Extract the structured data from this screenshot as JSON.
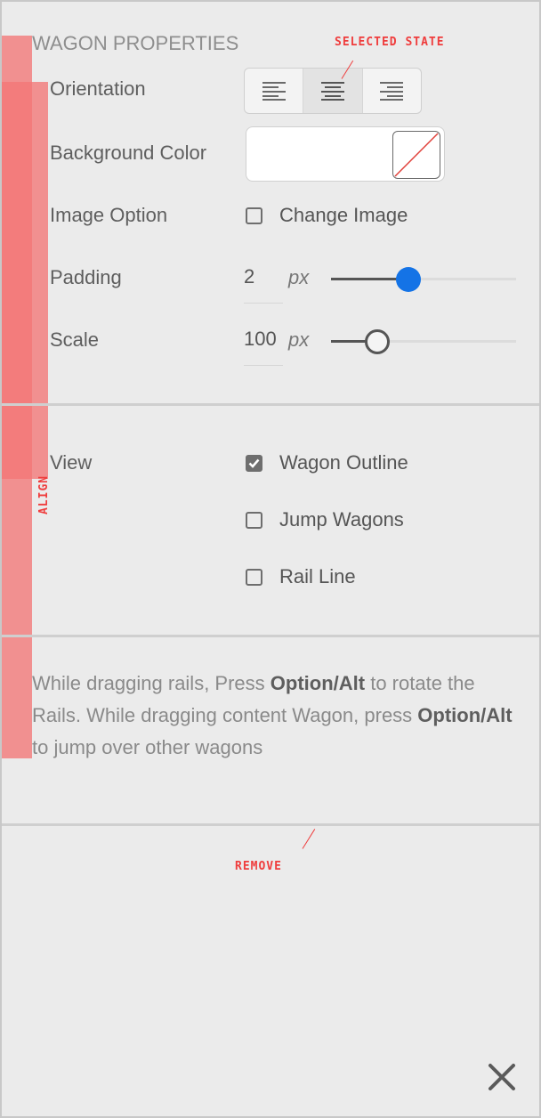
{
  "panel": {
    "title": "WAGON PROPERTIES",
    "orientation": {
      "label": "Orientation",
      "options": [
        "align-left",
        "align-center",
        "align-right"
      ],
      "selected": "align-center"
    },
    "background_color": {
      "label": "Background Color",
      "value": "none"
    },
    "image_option": {
      "label": "Image Option",
      "checkbox_label": "Change Image",
      "checked": false
    },
    "padding": {
      "label": "Padding",
      "value": "2",
      "unit": "px",
      "slider_fraction": 0.42,
      "slider_color": "#1473e6"
    },
    "scale": {
      "label": "Scale",
      "value": "100",
      "unit": "px",
      "slider_fraction": 0.25
    }
  },
  "view": {
    "label": "View",
    "options": [
      {
        "label": "Wagon Outline",
        "checked": true
      },
      {
        "label": "Jump Wagons",
        "checked": false
      },
      {
        "label": "Rail Line",
        "checked": false
      }
    ]
  },
  "help": {
    "part1": "While dragging rails, Press ",
    "bold1": "Option/Alt",
    "part2": " to rotate the Rails. While dragging content Wagon, press ",
    "bold2": "Option/Alt",
    "part3": " to jump over other wagons"
  },
  "annotations": {
    "selected_state": "SELECTED STATE",
    "align": "ALIGN",
    "remove": "REMOVE",
    "color": "#ef3d3d"
  },
  "close_icon": "close-icon"
}
